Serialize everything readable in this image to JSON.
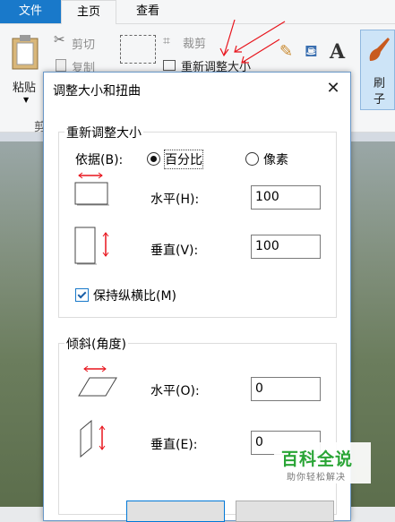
{
  "ribbon": {
    "tabs": [
      {
        "label": "文件"
      },
      {
        "label": "主页"
      },
      {
        "label": "查看"
      }
    ],
    "clipboard": {
      "paste_label": "粘贴",
      "cut_label": "剪切",
      "copy_label": "复制",
      "group_label_fragment": "剪"
    },
    "image": {
      "crop_label": "裁剪",
      "resize_label": "重新调整大小"
    },
    "brush": {
      "label_top": "刷",
      "label_bottom": "子"
    }
  },
  "dialog": {
    "title": "调整大小和扭曲",
    "resize": {
      "group_title": "重新调整大小",
      "basis_label": "依据(B):",
      "options": [
        {
          "label": "百分比",
          "selected": true
        },
        {
          "label": "像素",
          "selected": false
        }
      ],
      "horizontal_label": "水平(H):",
      "horizontal_value": "100",
      "vertical_label": "垂直(V):",
      "vertical_value": "100",
      "keep_ratio_label": "保持纵横比(M)",
      "keep_ratio_checked": true
    },
    "skew": {
      "group_title": "倾斜(角度)",
      "horizontal_label": "水平(O):",
      "horizontal_value": "0",
      "vertical_label": "垂直(E):",
      "vertical_value": "0"
    }
  },
  "watermark": {
    "title": "百科全说",
    "subtitle": "助你轻松解决"
  },
  "colors": {
    "accent": "#1979ca",
    "arrow_red": "#e8141c",
    "watermark_green": "#2aa536"
  }
}
